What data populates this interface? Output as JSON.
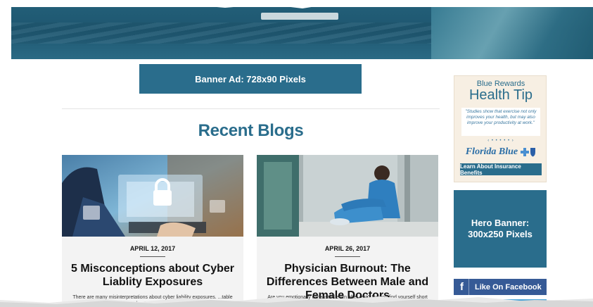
{
  "banner_ad": {
    "label": "Banner Ad: 728x90 Pixels"
  },
  "section": {
    "title": "Recent Blogs"
  },
  "posts": [
    {
      "date": "APRIL 12, 2017",
      "title": "5 Misconceptions about Cyber Liablity Exposures",
      "excerpt": "There are many misinterpretations about cyber liability exposures. ...table that you understand and are covered..."
    },
    {
      "date": "APRIL 26, 2017",
      "title": "Physician Burnout: The Differences Between Male and Female Doctors",
      "excerpt": "Are you emotionally exhausted even after rest? Do you find yourself short tempered or irritable when ..."
    }
  ],
  "sidebar": {
    "health_tip": {
      "kicker": "Blue Rewards",
      "heading": "Health Tip",
      "quote": "\"Studies show that exercise not only improves your health, but may also improve your productivity at work.\"",
      "pager": "‹ • • • • • ›",
      "brand": "Florida Blue",
      "cta": "Learn About Insurance Benefits"
    },
    "hero_banner": {
      "line1": "Hero Banner:",
      "line2": "300x250 Pixels"
    },
    "facebook": {
      "label": "Like On Facebook",
      "icon": "f"
    }
  },
  "colors": {
    "primary": "#2a6d8c",
    "facebook": "#365a96",
    "tip_bg": "#f7efe3"
  }
}
